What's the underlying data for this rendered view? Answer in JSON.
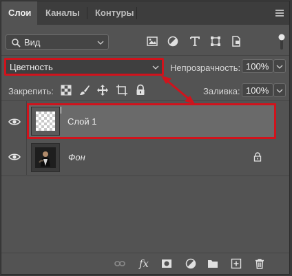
{
  "tabs": [
    {
      "label": "Слои",
      "active": true
    },
    {
      "label": "Каналы",
      "active": false
    },
    {
      "label": "Контуры",
      "active": false
    }
  ],
  "filter": {
    "kind_label": "Вид"
  },
  "blend": {
    "mode": "Цветность"
  },
  "opacity": {
    "label": "Непрозрачность:",
    "value": "100%"
  },
  "lock": {
    "label": "Закрепить:"
  },
  "fill": {
    "label": "Заливка:",
    "value": "100%"
  },
  "layers": [
    {
      "name": "Слой 1",
      "visible": true,
      "selected": true,
      "locked": false
    },
    {
      "name": "Фон",
      "visible": true,
      "selected": false,
      "locked": true
    }
  ],
  "bottom": {
    "fx_label": "fx"
  },
  "colors": {
    "panel": "#535353",
    "tabbar": "#3d3d3d",
    "highlight": "#d0131c",
    "selected_row": "#6a6a6a"
  }
}
